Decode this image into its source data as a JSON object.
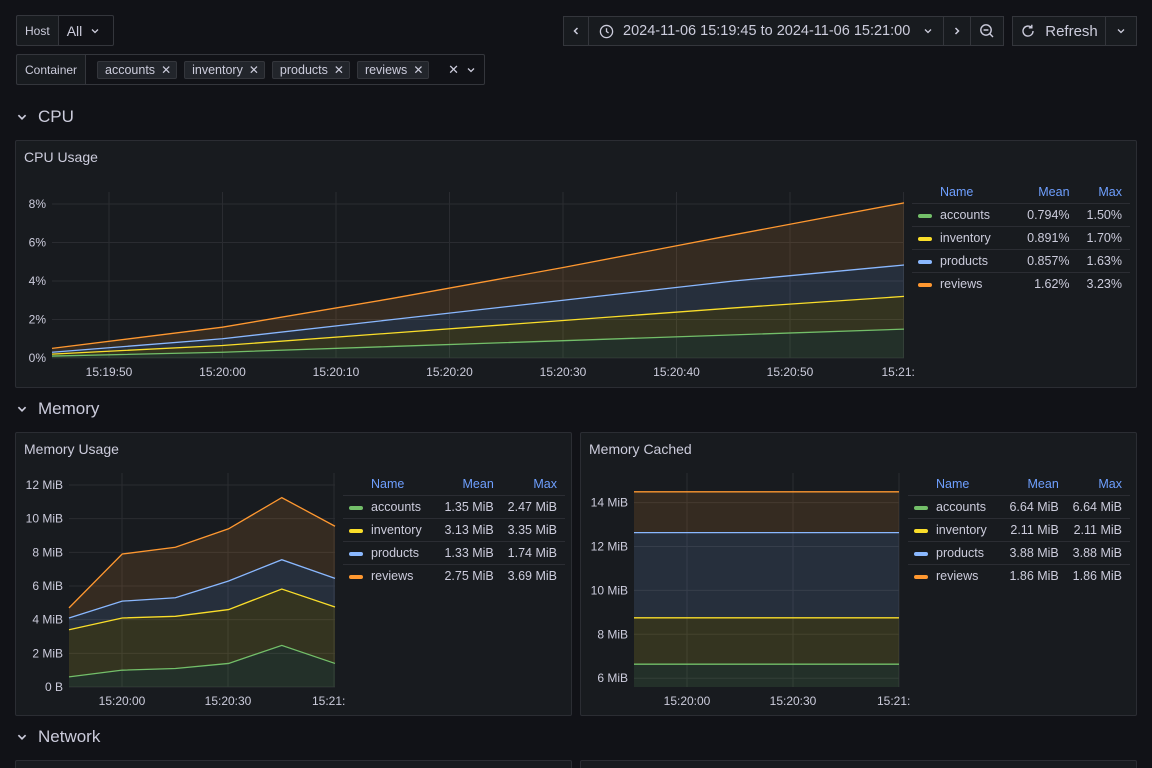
{
  "variables": {
    "host": {
      "label": "Host",
      "value": "All"
    },
    "container": {
      "label": "Container",
      "chips": [
        "accounts",
        "inventory",
        "products",
        "reviews"
      ]
    }
  },
  "toolbar": {
    "time_range": "2024-11-06 15:19:45 to 2024-11-06 15:21:00",
    "refresh_label": "Refresh"
  },
  "rows": {
    "cpu": "CPU",
    "memory": "Memory",
    "network": "Network"
  },
  "colors": {
    "accounts": "#73bf69",
    "inventory": "#fade2a",
    "products": "#8ab8ff",
    "reviews": "#ff9830"
  },
  "legend_headers": {
    "name": "Name",
    "mean": "Mean",
    "max": "Max"
  },
  "panels": {
    "cpu_usage": {
      "title": "CPU Usage",
      "legend": [
        {
          "name": "accounts",
          "mean": "0.794%",
          "max": "1.50%"
        },
        {
          "name": "inventory",
          "mean": "0.891%",
          "max": "1.70%"
        },
        {
          "name": "products",
          "mean": "0.857%",
          "max": "1.63%"
        },
        {
          "name": "reviews",
          "mean": "1.62%",
          "max": "3.23%"
        }
      ]
    },
    "memory_usage": {
      "title": "Memory Usage",
      "legend": [
        {
          "name": "accounts",
          "mean": "1.35 MiB",
          "max": "2.47 MiB"
        },
        {
          "name": "inventory",
          "mean": "3.13 MiB",
          "max": "3.35 MiB"
        },
        {
          "name": "products",
          "mean": "1.33 MiB",
          "max": "1.74 MiB"
        },
        {
          "name": "reviews",
          "mean": "2.75 MiB",
          "max": "3.69 MiB"
        }
      ]
    },
    "memory_cached": {
      "title": "Memory Cached",
      "legend": [
        {
          "name": "accounts",
          "mean": "6.64 MiB",
          "max": "6.64 MiB"
        },
        {
          "name": "inventory",
          "mean": "2.11 MiB",
          "max": "2.11 MiB"
        },
        {
          "name": "products",
          "mean": "3.88 MiB",
          "max": "3.88 MiB"
        },
        {
          "name": "reviews",
          "mean": "1.86 MiB",
          "max": "1.86 MiB"
        }
      ]
    }
  },
  "chart_data": [
    {
      "type": "area",
      "title": "CPU Usage",
      "stacked": true,
      "x": [
        "15:19:45",
        "15:20:00",
        "15:20:15",
        "15:20:30",
        "15:20:45",
        "15:21:00"
      ],
      "x_ticks": [
        "15:19:50",
        "15:20:00",
        "15:20:10",
        "15:20:20",
        "15:20:30",
        "15:20:40",
        "15:20:50",
        "15:21:"
      ],
      "y_ticks": [
        "0%",
        "2%",
        "4%",
        "6%",
        "8%"
      ],
      "ylim": [
        0,
        8
      ],
      "series": [
        {
          "name": "accounts",
          "values": [
            0.1,
            0.3,
            0.6,
            0.9,
            1.2,
            1.5
          ]
        },
        {
          "name": "inventory",
          "values": [
            0.1,
            0.35,
            0.7,
            1.05,
            1.4,
            1.7
          ]
        },
        {
          "name": "products",
          "values": [
            0.1,
            0.35,
            0.7,
            1.05,
            1.4,
            1.63
          ]
        },
        {
          "name": "reviews",
          "values": [
            0.2,
            0.6,
            1.1,
            1.7,
            2.4,
            3.23
          ]
        }
      ]
    },
    {
      "type": "area",
      "title": "Memory Usage",
      "stacked": true,
      "x": [
        "15:19:45",
        "15:20:00",
        "15:20:15",
        "15:20:30",
        "15:20:45",
        "15:21:00"
      ],
      "x_ticks": [
        "15:20:00",
        "15:20:30",
        "15:21:"
      ],
      "y_ticks": [
        "0 B",
        "2 MiB",
        "4 MiB",
        "6 MiB",
        "8 MiB",
        "10 MiB",
        "12 MiB"
      ],
      "ylim": [
        0,
        12
      ],
      "series": [
        {
          "name": "accounts",
          "values": [
            0.6,
            1.0,
            1.1,
            1.4,
            2.47,
            1.4
          ]
        },
        {
          "name": "inventory",
          "values": [
            2.8,
            3.1,
            3.1,
            3.2,
            3.35,
            3.35
          ]
        },
        {
          "name": "products",
          "values": [
            0.7,
            1.0,
            1.1,
            1.7,
            1.74,
            1.7
          ]
        },
        {
          "name": "reviews",
          "values": [
            0.6,
            2.8,
            3.0,
            3.1,
            3.69,
            3.1
          ]
        }
      ]
    },
    {
      "type": "area",
      "title": "Memory Cached",
      "stacked": true,
      "x": [
        "15:19:45",
        "15:20:00",
        "15:20:15",
        "15:20:30",
        "15:20:45",
        "15:21:00"
      ],
      "x_ticks": [
        "15:20:00",
        "15:20:30",
        "15:21:"
      ],
      "y_ticks": [
        "6 MiB",
        "8 MiB",
        "10 MiB",
        "12 MiB",
        "14 MiB"
      ],
      "ylim": [
        5.6,
        14.8
      ],
      "series": [
        {
          "name": "accounts",
          "values": [
            6.64,
            6.64,
            6.64,
            6.64,
            6.64,
            6.64
          ]
        },
        {
          "name": "inventory",
          "values": [
            2.11,
            2.11,
            2.11,
            2.11,
            2.11,
            2.11
          ]
        },
        {
          "name": "products",
          "values": [
            3.88,
            3.88,
            3.88,
            3.88,
            3.88,
            3.88
          ]
        },
        {
          "name": "reviews",
          "values": [
            1.86,
            1.86,
            1.86,
            1.86,
            1.86,
            1.86
          ]
        }
      ]
    }
  ]
}
